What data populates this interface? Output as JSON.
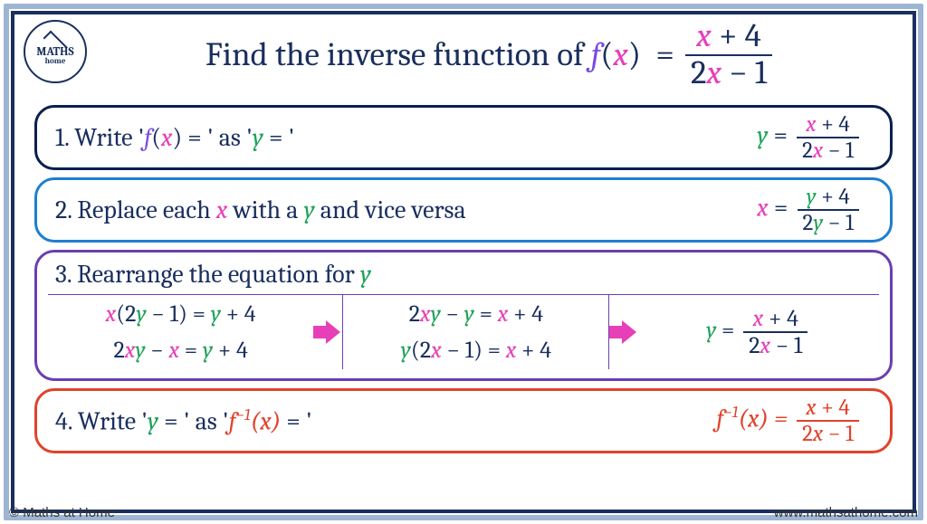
{
  "title": {
    "prefix": "Find the inverse function of ",
    "fn": "f",
    "arg": "x",
    "num_a": "x",
    "num_b": " + 4",
    "den_a": "2",
    "den_x": "x",
    "den_b": " − 1"
  },
  "logo": {
    "line1": "MATHS",
    "line2": "home"
  },
  "step1": {
    "label_a": "1. Write '",
    "label_f": "f",
    "label_paren_x": "x",
    "label_b": " = ' as '",
    "label_y": "y",
    "label_c": " = '",
    "eq_y": "y",
    "eq_eq": "  = ",
    "num_x": "x",
    "num_rest": " + 4",
    "den_pre": "2",
    "den_x": "x",
    "den_rest": " − 1"
  },
  "step2": {
    "label_a": "2. Replace each ",
    "label_x": "x",
    "label_b": " with a ",
    "label_y": "y",
    "label_c": " and vice versa",
    "eq_x": "x",
    "eq_eq": "  = ",
    "num_y": "y",
    "num_rest": " + 4",
    "den_pre": "2",
    "den_y": "y",
    "den_rest": " − 1"
  },
  "step3": {
    "head_a": "3. Rearrange the equation for ",
    "head_y": "y",
    "c1r1_x": "x",
    "c1r1_a": "(2",
    "c1r1_y": "y",
    "c1r1_b": " − 1)  =  ",
    "c1r1_y2": "y",
    "c1r1_c": " + 4",
    "c1r2_a": "2",
    "c1r2_x": "x",
    "c1r2_y": "y",
    "c1r2_b": " − ",
    "c1r2_x2": "x",
    "c1r2_c": "  =  ",
    "c1r2_y2": "y",
    "c1r2_d": " + 4",
    "c2r1_a": "2",
    "c2r1_x": "x",
    "c2r1_y": "y",
    "c2r1_b": " − ",
    "c2r1_y2": "y",
    "c2r1_c": "  =  ",
    "c2r1_x2": "x",
    "c2r1_d": " + 4",
    "c2r2_y": "y",
    "c2r2_a": "(2",
    "c2r2_x": "x",
    "c2r2_b": "  − 1)  =   ",
    "c2r2_x2": "x",
    "c2r2_c": " + 4",
    "c3_y": "y",
    "c3_eq": "  = ",
    "c3_num_x": "x",
    "c3_num_rest": "  + 4",
    "c3_den_a": "2",
    "c3_den_x": "x",
    "c3_den_b": " − 1"
  },
  "step4": {
    "label_a": "4. Write '",
    "label_y": "y",
    "label_b": " = ' as '",
    "label_f": "f",
    "label_exp": "−1",
    "label_x": "x",
    "label_c": " = '",
    "eq_f": "f",
    "eq_exp": "−1",
    "eq_x": "x",
    "eq_eq": " = ",
    "num_x": "x",
    "num_rest": "  + 4",
    "den_a": "2",
    "den_x": "x",
    "den_b": " − 1"
  },
  "footer": {
    "left": "© Maths at Home",
    "right": "www.mathsathome.com"
  }
}
